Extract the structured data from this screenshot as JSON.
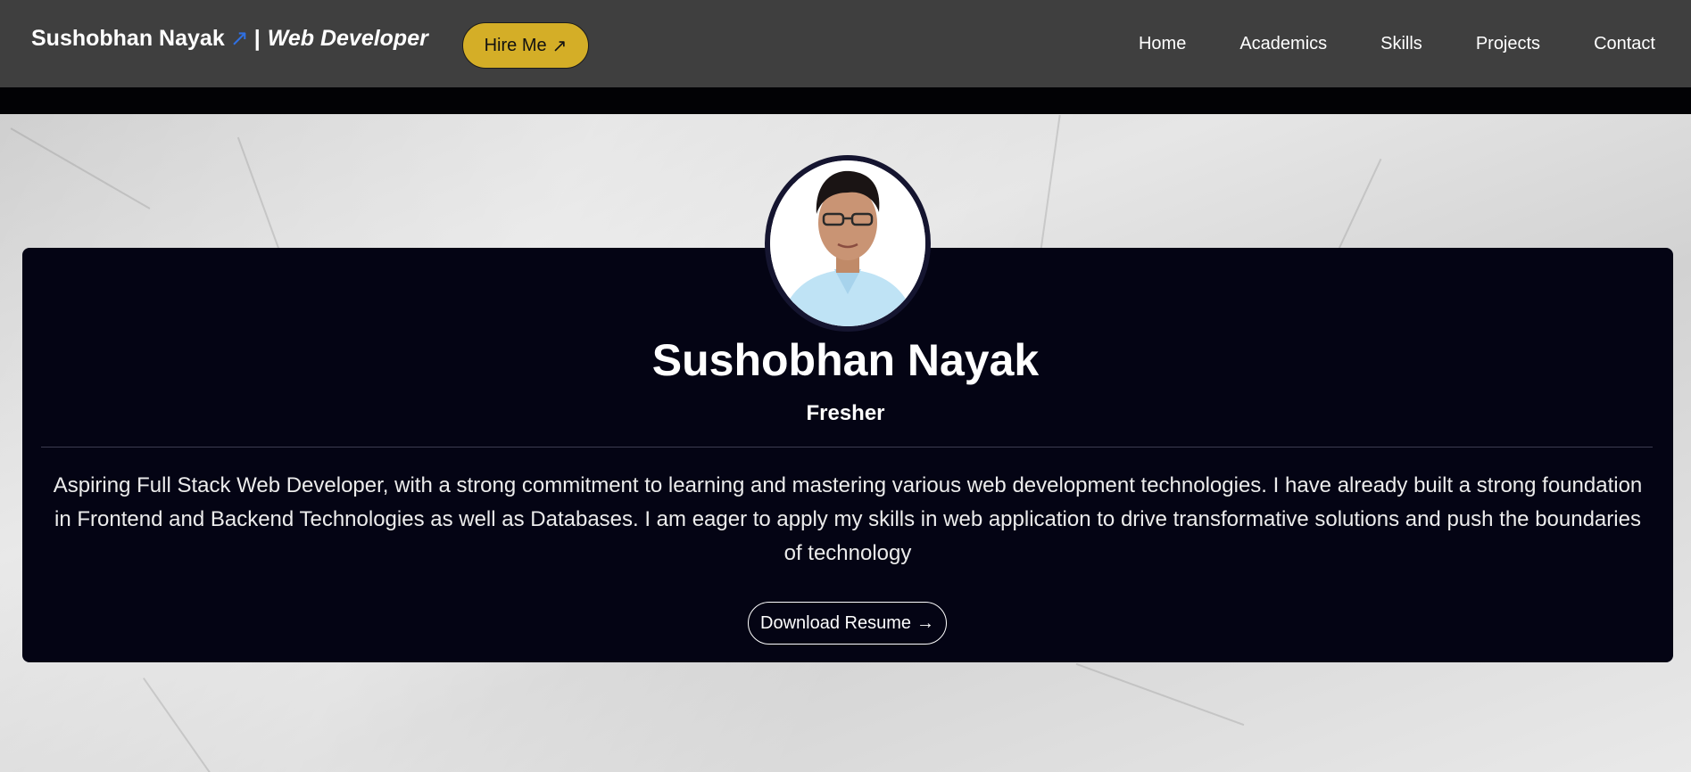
{
  "brand": {
    "name": "Sushobhan Nayak",
    "arrow": "↗",
    "separator": "|",
    "role": "Web Developer"
  },
  "hire_button": {
    "label": "Hire Me",
    "icon": "↗"
  },
  "nav": {
    "items": [
      {
        "label": "Home"
      },
      {
        "label": "Academics"
      },
      {
        "label": "Skills"
      },
      {
        "label": "Projects"
      },
      {
        "label": "Contact"
      }
    ]
  },
  "profile": {
    "name": "Sushobhan Nayak",
    "subtitle": "Fresher",
    "bio": "Aspiring Full Stack Web Developer, with a strong commitment to learning and mastering various web development technologies. I have already built a strong foundation in Frontend and Backend Technologies as well as Databases. I am eager to apply my skills in web application to drive transformative solutions and push the boundaries of technology",
    "resume_button": {
      "label": "Download Resume",
      "icon": "→"
    }
  },
  "colors": {
    "navbar_bg": "#3f3f3f",
    "accent_yellow": "#d4ae27",
    "card_bg": "#040414",
    "brand_arrow": "#2f6fe0"
  }
}
